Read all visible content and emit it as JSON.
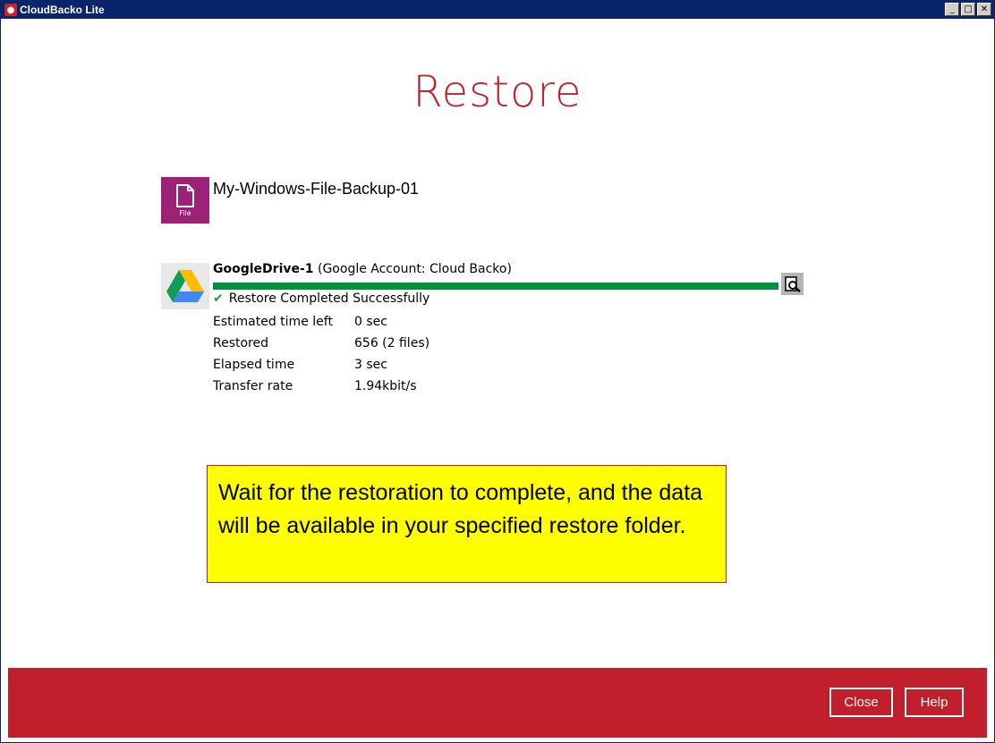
{
  "window": {
    "title": "CloudBacko Lite",
    "controls": [
      "_",
      "□",
      "✕"
    ]
  },
  "page": {
    "heading": "Restore"
  },
  "backup_set": {
    "name": "My-Windows-File-Backup-01",
    "tile_caption": "File",
    "icon": "file-icon",
    "tile_color": "#9b2276"
  },
  "destination": {
    "name": "GoogleDrive-1",
    "account": "(Google Account: Cloud Backo)",
    "icon": "google-drive-icon",
    "progress": 1.0,
    "status_text": "Restore Completed Successfully"
  },
  "details": [
    {
      "label": "Estimated time left",
      "value": "0 sec"
    },
    {
      "label": "Restored",
      "value": "656 (2 files)"
    },
    {
      "label": "Elapsed time",
      "value": "3 sec"
    },
    {
      "label": "Transfer rate",
      "value": "1.94kbit/s"
    }
  ],
  "note": {
    "text": "Wait for the restoration to complete, and the data will be available in your specified restore folder."
  },
  "footer": {
    "close_label": "Close",
    "help_label": "Help"
  },
  "colors": {
    "accent_red": "#c11f2c",
    "progress_green": "#009040",
    "note_yellow": "#ffff00"
  }
}
